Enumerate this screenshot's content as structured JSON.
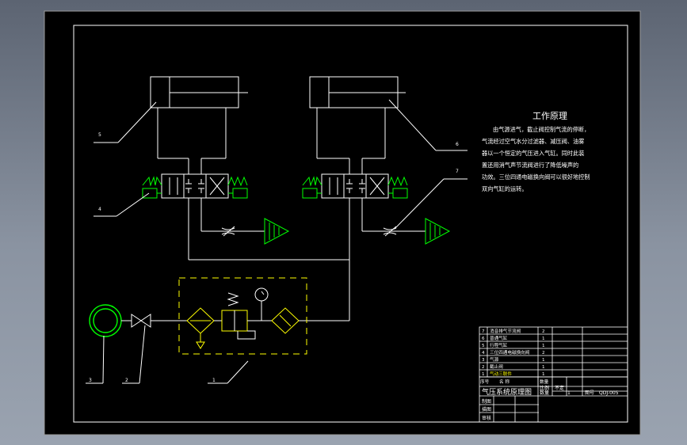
{
  "work_principle": {
    "title": "工作原理",
    "lines": [
      "由气源进气，截止阀控制气流的停断，",
      "气流经过空气水分过滤器、减压阀、油雾",
      "器以一个恒定的气压进入气缸。同时此装",
      "置还用消气声节流阀进行了降低噪声的",
      "功效。三位四通电磁换向阀可以很好地控制",
      "双向气缸的运转。"
    ]
  },
  "leader_labels": {
    "n5": "5",
    "n4": "4",
    "n6": "6",
    "n7": "7",
    "n3": "3",
    "n2": "2",
    "n1": "1"
  },
  "bom": {
    "rows": [
      {
        "no": "7",
        "name": "消音排气节流阀",
        "qty": "2"
      },
      {
        "no": "6",
        "name": "普通气缸",
        "qty": "1"
      },
      {
        "no": "5",
        "name": "行程气缸",
        "qty": "1"
      },
      {
        "no": "4",
        "name": "三位四通电磁换向阀",
        "qty": "2"
      },
      {
        "no": "3",
        "name": "气源",
        "qty": "1"
      },
      {
        "no": "2",
        "name": "截止阀",
        "qty": "1"
      },
      {
        "no": "1",
        "name": "气动三联件",
        "qty": "1"
      }
    ],
    "header": {
      "no": "序号",
      "name": "名  称",
      "qty": "数量"
    }
  },
  "title_block": {
    "drawing_name": "气压系统原理图",
    "scale_label": "比例",
    "scale_value": "不定",
    "count_label": "数量",
    "count_value": "1",
    "code_label": "图号",
    "code_value": "QDJ-005",
    "designer": "制图",
    "checker": "描图",
    "approver": "审核"
  },
  "colors": {
    "background": "#000000",
    "lines": "#ffffff",
    "valve": "#00ff00",
    "fittings": "#ffff00",
    "frame_gray": "#c0c0c0"
  }
}
